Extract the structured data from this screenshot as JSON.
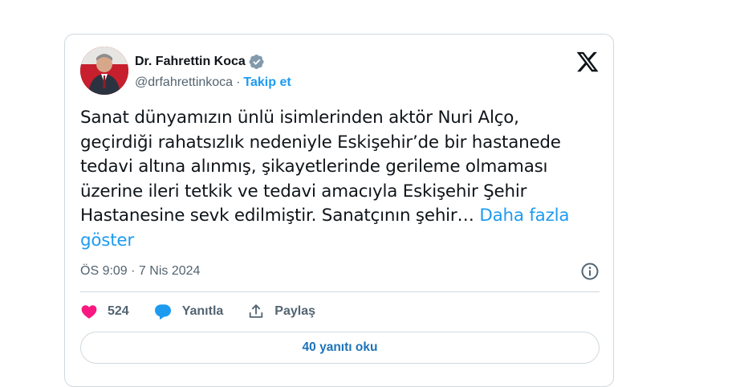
{
  "author": {
    "name": "Dr. Fahrettin Koca",
    "handle": "@drfahrettinkoca",
    "separator": "·",
    "follow_label": "Takip et",
    "avatar_icon": "person-avatar",
    "verified_icon": "verified-badge-icon"
  },
  "brand": {
    "logo_icon": "x-logo-icon"
  },
  "tweet": {
    "text": "Sanat dünyamızın ünlü isimlerinden aktör Nuri Alço, geçirdiği rahatsızlık nedeniyle Eskişehir’de bir hastanede tedavi altına alınmış, şikayetlerinde gerileme olmaması üzerine ileri tetkik ve tedavi amacıyla Eskişehir Şehir Hastanesine sevk edilmiştir. Sanatçının şehir…",
    "more_label": "Daha fazla göster",
    "timestamp": "ÖS 9:09 · 7 Nis 2024"
  },
  "actions": {
    "like_count": "524",
    "reply_label": "Yanıtla",
    "share_label": "Paylaş"
  },
  "replies_button": {
    "label": "40 yanıtı oku"
  },
  "colors": {
    "accent": "#1d9bf0",
    "like": "#f91880",
    "border": "#cfd9de",
    "muted": "#536471"
  }
}
